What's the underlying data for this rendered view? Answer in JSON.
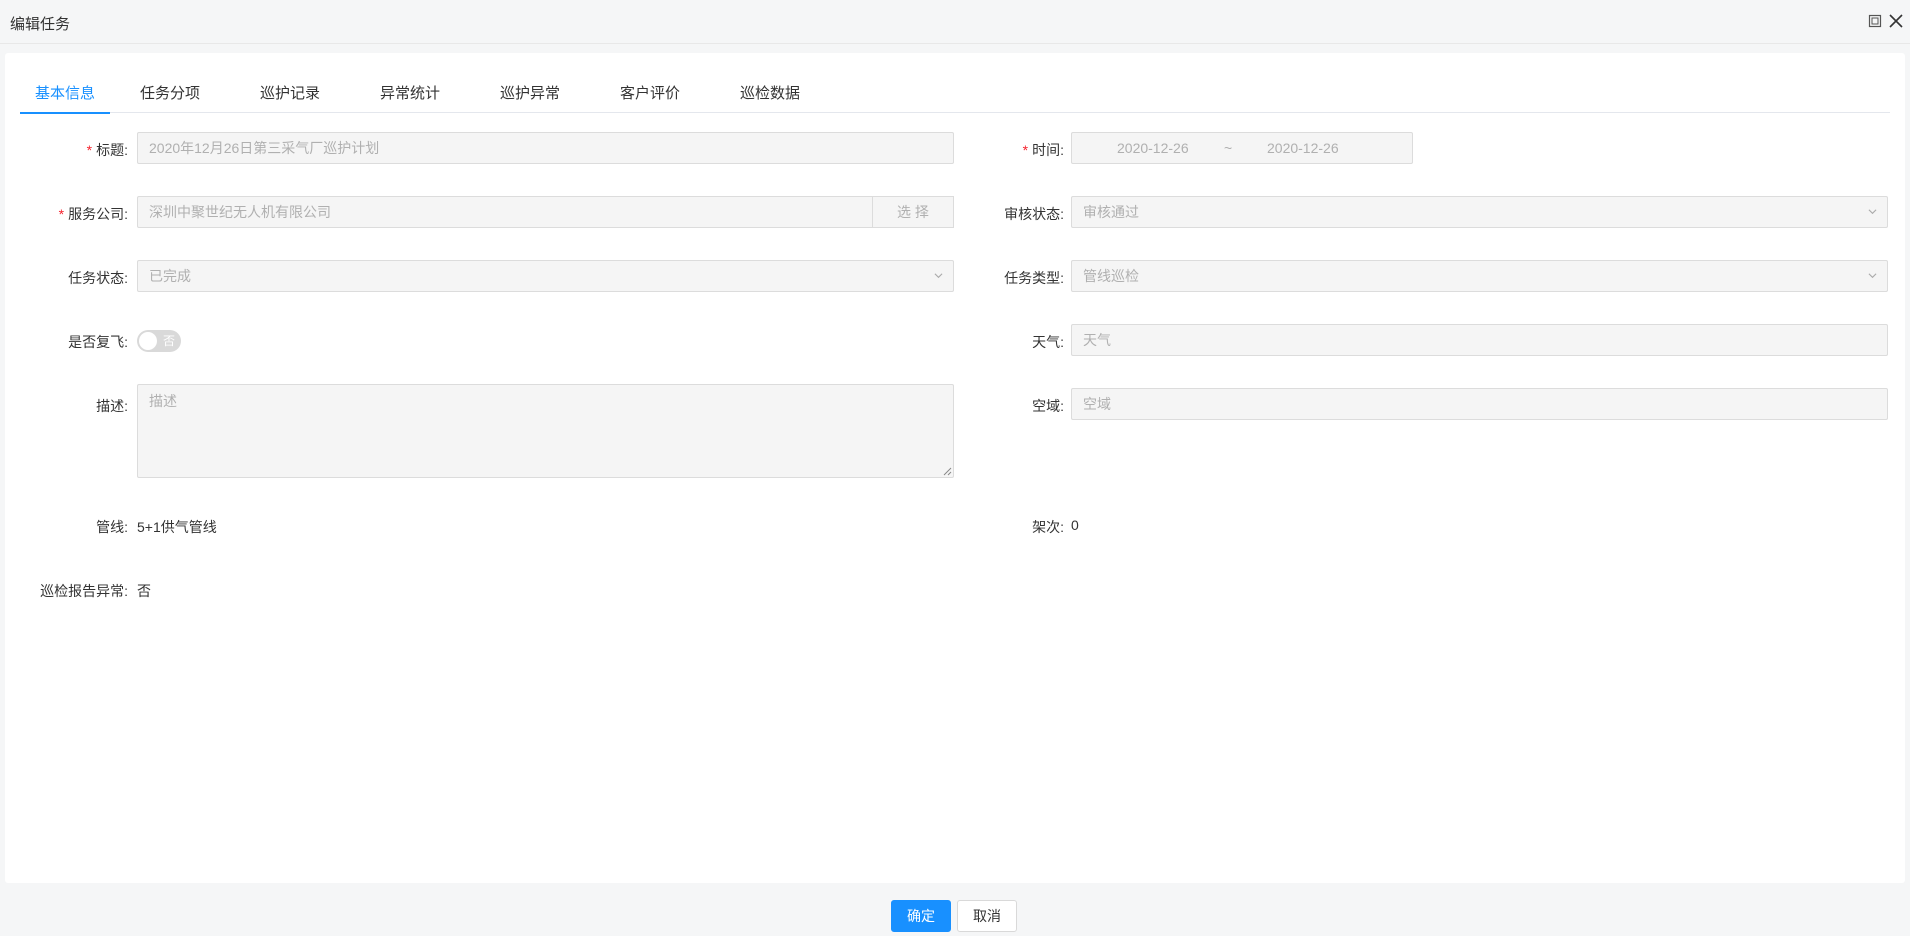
{
  "window": {
    "title": "编辑任务"
  },
  "tabs": [
    {
      "label": "基本信息"
    },
    {
      "label": "任务分项"
    },
    {
      "label": "巡护记录"
    },
    {
      "label": "异常统计"
    },
    {
      "label": "巡护异常"
    },
    {
      "label": "客户评价"
    },
    {
      "label": "巡检数据"
    }
  ],
  "form": {
    "title": {
      "label": "标题:",
      "value": "2020年12月26日第三采气厂巡护计划"
    },
    "time": {
      "label": "时间:",
      "start": "2020-12-26",
      "sep": "~",
      "end": "2020-12-26"
    },
    "company": {
      "label": "服务公司:",
      "value": "深圳中聚世纪无人机有限公司",
      "button": "选 择"
    },
    "audit": {
      "label": "审核状态:",
      "value": "审核通过"
    },
    "task_status": {
      "label": "任务状态:",
      "value": "已完成"
    },
    "task_type": {
      "label": "任务类型:",
      "value": "管线巡检"
    },
    "refly": {
      "label": "是否复飞:",
      "toggle_text": "否"
    },
    "weather": {
      "label": "天气:",
      "placeholder": "天气"
    },
    "desc": {
      "label": "描述:",
      "placeholder": "描述"
    },
    "airspace": {
      "label": "空域:",
      "placeholder": "空域"
    },
    "pipeline": {
      "label": "管线:",
      "value": "5+1供气管线"
    },
    "sorties": {
      "label": "架次:",
      "value": "0"
    },
    "report": {
      "label": "巡检报告异常:",
      "value": "否"
    }
  },
  "footer": {
    "ok": "确定",
    "cancel": "取消"
  },
  "colors": {
    "accent": "#1890ff",
    "required": "#f5222d"
  }
}
